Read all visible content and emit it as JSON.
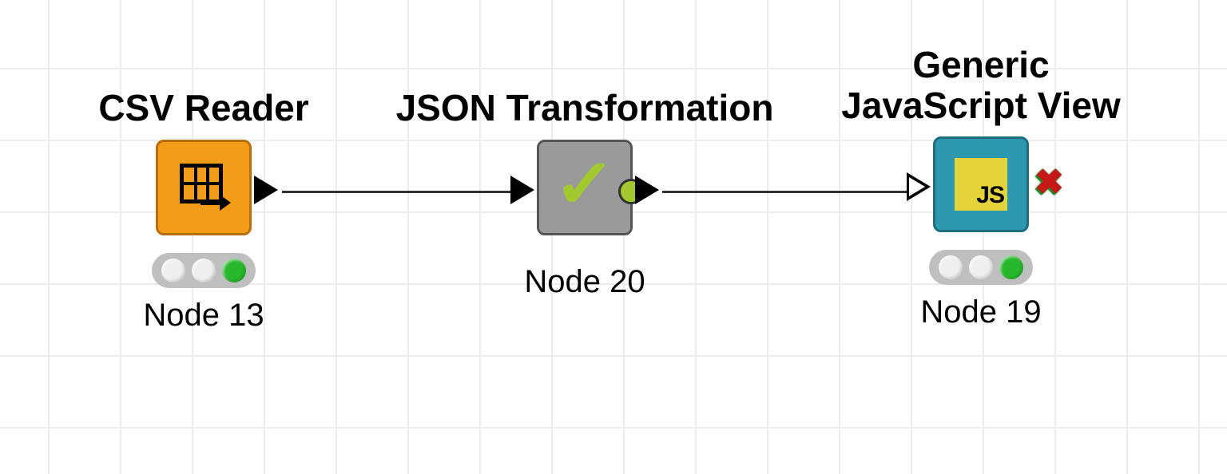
{
  "nodes": {
    "csv_reader": {
      "title": "CSV Reader",
      "id_label": "Node 13",
      "icon": "table-export-icon",
      "box_color": "#f39c1a",
      "border_color": "#b86f0a",
      "status": [
        "#efefef",
        "#efefef",
        "#27b82b"
      ]
    },
    "json_transform": {
      "title": "JSON Transformation",
      "id_label": "Node 20",
      "icon": "checkmark-icon",
      "box_color": "#9a9a9a",
      "border_color": "#555555"
    },
    "js_view": {
      "title_line1": "Generic",
      "title_line2": "JavaScript View",
      "id_label": "Node 19",
      "icon": "js-icon",
      "icon_text": "JS",
      "box_color": "#2e98af",
      "border_color": "#1e6e80",
      "status": [
        "#efefef",
        "#efefef",
        "#27b82b"
      ]
    }
  }
}
